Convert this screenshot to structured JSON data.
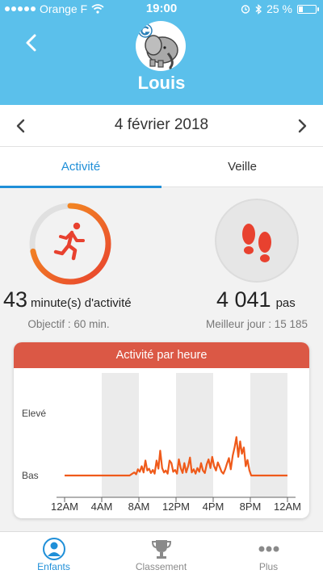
{
  "status_bar": {
    "carrier": "Orange F",
    "time": "19:00",
    "battery": "25 %",
    "battery_level": 0.25
  },
  "header": {
    "child_name": "Louis"
  },
  "date_nav": {
    "date": "4 février 2018"
  },
  "tabs": [
    {
      "label": "Activité",
      "active": true
    },
    {
      "label": "Veille",
      "active": false
    }
  ],
  "activity": {
    "value": "43",
    "unit": "minute(s) d'activité",
    "goal_text": "Objectif : 60 min.",
    "progress": 0.717
  },
  "steps": {
    "value": "4 041",
    "unit": "pas",
    "best_text": "Meilleur jour : 15 185"
  },
  "colors": {
    "header_bg": "#5bc0eb",
    "accent_blue": "#1f8fd8",
    "activity_red": "#db5845",
    "activity_orange": "#f5871f",
    "line_orange": "#ef5a1a"
  },
  "chart_data": {
    "type": "area",
    "title": "Activité par heure",
    "y_levels": [
      "Elevé",
      "Bas"
    ],
    "x_ticks": [
      "12AM",
      "4AM",
      "8AM",
      "12PM",
      "4PM",
      "8PM",
      "12AM"
    ],
    "x_range": [
      0,
      24
    ],
    "y_range": [
      0,
      1
    ],
    "x": [
      0,
      7.0,
      7.3,
      7.5,
      7.7,
      7.9,
      8.1,
      8.3,
      8.5,
      8.7,
      8.9,
      9.1,
      9.3,
      9.5,
      9.7,
      9.9,
      10.1,
      10.3,
      10.5,
      10.7,
      10.9,
      11.1,
      11.3,
      11.5,
      11.7,
      11.9,
      12.1,
      12.3,
      12.5,
      12.7,
      12.9,
      13.1,
      13.3,
      13.5,
      13.7,
      13.9,
      14.1,
      14.3,
      14.5,
      14.7,
      14.9,
      15.1,
      15.3,
      15.5,
      15.7,
      15.9,
      16.1,
      16.3,
      16.5,
      16.7,
      16.9,
      17.1,
      17.3,
      17.5,
      17.7,
      17.9,
      18.1,
      18.3,
      18.5,
      18.7,
      18.9,
      19.1,
      19.3,
      19.5,
      19.7,
      19.9,
      20.1,
      24
    ],
    "y": [
      0,
      0,
      0.03,
      0.05,
      0.02,
      0.1,
      0.06,
      0.15,
      0.05,
      0.24,
      0.08,
      0.11,
      0.04,
      0.09,
      0.03,
      0.24,
      0.11,
      0.4,
      0.12,
      0.05,
      0.08,
      0.03,
      0.24,
      0.2,
      0.06,
      0.09,
      0.03,
      0.26,
      0.12,
      0.04,
      0.2,
      0.05,
      0.15,
      0.29,
      0.05,
      0.1,
      0.03,
      0.12,
      0.06,
      0.2,
      0.08,
      0.04,
      0.18,
      0.26,
      0.12,
      0.3,
      0.15,
      0.08,
      0.21,
      0.14,
      0.06,
      0.03,
      0.1,
      0.2,
      0.28,
      0.1,
      0.32,
      0.45,
      0.62,
      0.3,
      0.55,
      0.35,
      0.45,
      0.15,
      0.25,
      0.08,
      0,
      0
    ],
    "shaded_bands": [
      [
        4,
        8
      ],
      [
        12,
        16
      ],
      [
        20,
        24
      ]
    ]
  },
  "tab_bar": [
    {
      "label": "Enfants",
      "icon": "child-icon",
      "active": true
    },
    {
      "label": "Classement",
      "icon": "trophy-icon",
      "active": false
    },
    {
      "label": "Plus",
      "icon": "more-icon",
      "active": false
    }
  ]
}
